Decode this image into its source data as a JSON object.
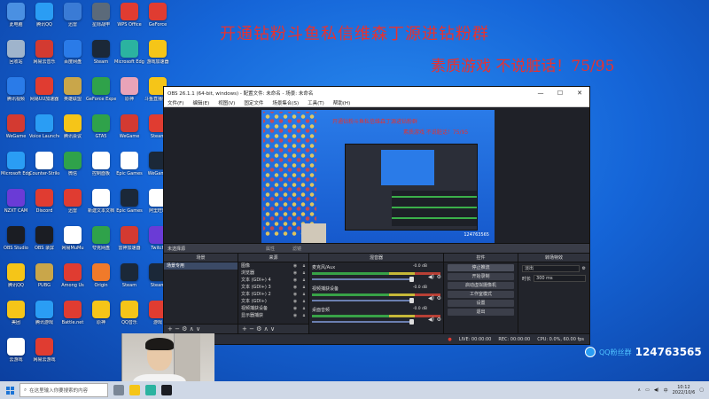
{
  "desktop": {
    "icons": [
      {
        "label": "此电脑",
        "color": "#4a90e2"
      },
      {
        "label": "腾讯QQ",
        "color": "#2a9df4"
      },
      {
        "label": "迅雷",
        "color": "#3a7bd5"
      },
      {
        "label": "星际战甲",
        "color": "#5b6a7a"
      },
      {
        "label": "WPS Office",
        "color": "#e03c31"
      },
      {
        "label": "GeForce",
        "color": "#e03c31"
      },
      {
        "label": "回收站",
        "color": "#9fb4cc"
      },
      {
        "label": "网易云音乐",
        "color": "#d33a31"
      },
      {
        "label": "百度网盘",
        "color": "#2a7be8"
      },
      {
        "label": "Steam",
        "color": "#1b2838"
      },
      {
        "label": "Microsoft Edge",
        "color": "#2bb3a0"
      },
      {
        "label": "游戏加速器",
        "color": "#f5c518"
      },
      {
        "label": "腾讯视频",
        "color": "#2a7be8"
      },
      {
        "label": "网易UU加速器",
        "color": "#e03c31"
      },
      {
        "label": "英雄联盟",
        "color": "#c9a64a"
      },
      {
        "label": "GeForce Experience",
        "color": "#2fa24a"
      },
      {
        "label": "原神",
        "color": "#e9a3b8"
      },
      {
        "label": "斗鱼直播伴侣",
        "color": "#f5c518"
      },
      {
        "label": "WeGame",
        "color": "#d33a31"
      },
      {
        "label": "Voice Launcher",
        "color": "#2a9df4"
      },
      {
        "label": "腾讯会议",
        "color": "#f5c518"
      },
      {
        "label": "GTA5",
        "color": "#2fa24a"
      },
      {
        "label": "WeGame",
        "color": "#d33a31"
      },
      {
        "label": "Steam",
        "color": "#e03c31"
      },
      {
        "label": "Microsoft Edge",
        "color": "#2a9df4"
      },
      {
        "label": "Counter-Strike",
        "color": "#ffffff"
      },
      {
        "label": "微信",
        "color": "#2fa24a"
      },
      {
        "label": "控制面板",
        "color": "#ffffff"
      },
      {
        "label": "Epic Games",
        "color": "#ffffff"
      },
      {
        "label": "WeGame",
        "color": "#1b2838"
      },
      {
        "label": "NZXT CAM",
        "color": "#6a3bd6"
      },
      {
        "label": "Discord",
        "color": "#e03c31"
      },
      {
        "label": "迅雷",
        "color": "#e03c31"
      },
      {
        "label": "新建文本文档",
        "color": "#ffffff"
      },
      {
        "label": "Epic Games",
        "color": "#1b2838"
      },
      {
        "label": "阿里旺旺",
        "color": "#ffffff"
      },
      {
        "label": "OBS Studio",
        "color": "#1b1d23"
      },
      {
        "label": "OBS 录屏",
        "color": "#1b1d23"
      },
      {
        "label": "网易MuMu",
        "color": "#ffffff"
      },
      {
        "label": "夸克网盘",
        "color": "#2fa24a"
      },
      {
        "label": "雷神加速器",
        "color": "#d33a31"
      },
      {
        "label": "Twitch",
        "color": "#6a3bd6"
      },
      {
        "label": "腾讯QQ",
        "color": "#f5c518"
      },
      {
        "label": "PUBG",
        "color": "#c9a64a"
      },
      {
        "label": "Among Us",
        "color": "#e03c31"
      },
      {
        "label": "Origin",
        "color": "#f07a2a"
      },
      {
        "label": "Steam",
        "color": "#1b2838"
      },
      {
        "label": "Steam",
        "color": "#1b2838"
      },
      {
        "label": "美团",
        "color": "#f5c518"
      },
      {
        "label": "腾讯游戏",
        "color": "#2a9df4"
      },
      {
        "label": "Battle.net",
        "color": "#e03c31"
      },
      {
        "label": "原神",
        "color": "#f5c518"
      },
      {
        "label": "QQ音乐",
        "color": "#f5c518"
      },
      {
        "label": "游戏",
        "color": "#e03c31"
      },
      {
        "label": "云游戏",
        "color": "#ffffff"
      },
      {
        "label": "网易云游戏",
        "color": "#e03c31"
      }
    ]
  },
  "promo": {
    "line1": "开通钻粉斗鱼私信维森丁源进钻粉群",
    "line2": "素质游戏 不说脏话！75/95"
  },
  "obs": {
    "title": "OBS 26.1.1 (64-bit, windows) - 配置文件: 未命名 - 场景: 未命名",
    "win_min": "—",
    "win_max": "☐",
    "win_close": "✕",
    "menu": [
      "文件(F)",
      "编辑(E)",
      "视图(V)",
      "固定文件",
      "场景集合(S)",
      "工具(T)",
      "帮助(H)"
    ],
    "preview_text1": "开通钻粉斗鱼私信维森丁源进钻粉群",
    "preview_text2": "素质游戏 不说脏话！75/95",
    "preview_qq": "124763565",
    "dock_tab": "未选择源",
    "dock_props": "属性",
    "dock_filters": "滤镜",
    "scenes_header": "场景",
    "scenes": [
      "场景专用"
    ],
    "sources_header": "来源",
    "sources": [
      "图像",
      "浏览器",
      "文本 (GDI+) 4",
      "文本 (GDI+) 3",
      "文本 (GDI+) 2",
      "文本 (GDI+)",
      "视频捕获设备",
      "显示器捕获"
    ],
    "mixer_header": "混音器",
    "mixer": [
      {
        "name": "麦克风/Aux",
        "db": "-0.0 dB"
      },
      {
        "name": "视频捕获设备",
        "db": "-0.0 dB"
      },
      {
        "name": "桌面音频",
        "db": "-0.0 dB"
      }
    ],
    "transitions_header": "转场特效",
    "transition_type": "淡出",
    "duration_label": "时长",
    "duration_value": "300 ms",
    "controls_header": "控件",
    "controls": [
      "停止推流",
      "开始录制",
      "启动虚拟摄像机",
      "工作室模式",
      "设置",
      "退出"
    ],
    "status": [
      "LIVE: 00:00:00",
      "REC: 00:00:00",
      "CPU: 0.0%, 60.00 fps"
    ],
    "footer_plus": "+ − ⚙ ∧ ∨"
  },
  "overlay": {
    "qq_label": "QQ粉丝群",
    "qq_number": "124763565"
  },
  "taskbar": {
    "search_placeholder": "在这里输入你要搜索的内容",
    "clock_time": "10:12",
    "clock_date": "2022/10/6",
    "lang": "中"
  }
}
